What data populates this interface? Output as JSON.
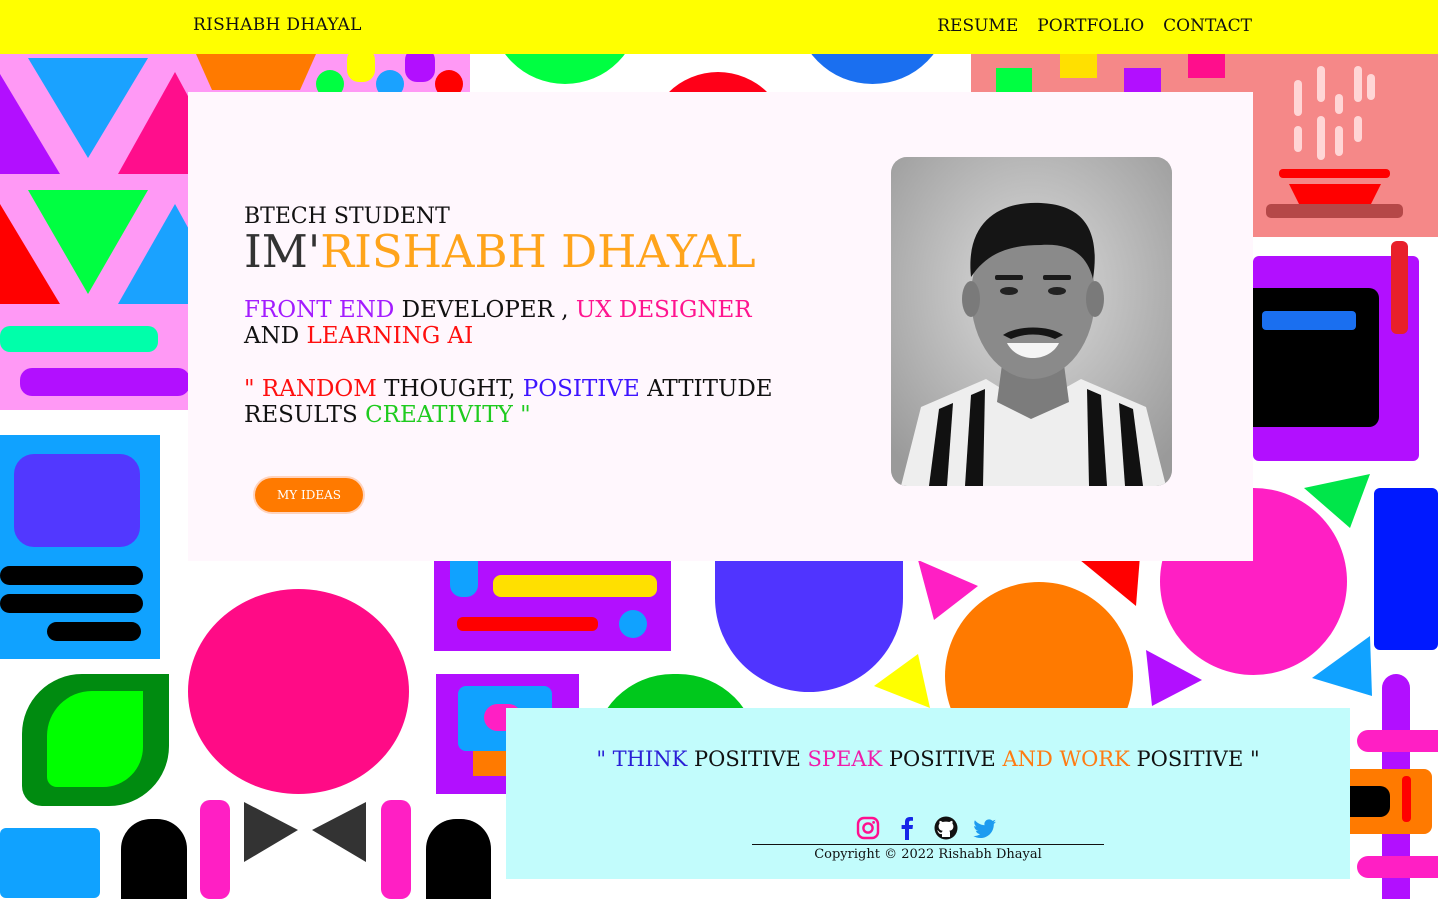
{
  "nav": {
    "brand": "RISHABH DHAYAL",
    "links": [
      "RESUME",
      "PORTFOLIO",
      "CONTACT"
    ]
  },
  "hero": {
    "subtitle": "BTECH STUDENT",
    "im_prefix": "IM'",
    "name": "RISHABH DHAYAL",
    "roles": {
      "front_end": "FRONT END",
      "developer": " DEVELOPER , ",
      "ux_designer": "UX DESIGNER",
      "and": "AND ",
      "learning_ai": "LEARNING AI"
    },
    "quote": {
      "open": "\" RANDOM",
      "thought": " THOUGHT, ",
      "positive": "POSITIVE",
      "attitude": " ATTITUDE",
      "results": "RESULTS ",
      "creativity": "CREATIVITY \""
    },
    "button_label": "MY IDEAS"
  },
  "footer": {
    "motto": {
      "open": "\" THINK",
      "pos1": " POSITIVE ",
      "speak": "SPEAK",
      "pos2": " POSITIVE ",
      "andwork": "AND WORK",
      "pos3": " POSITIVE \""
    },
    "socials": [
      "instagram-icon",
      "facebook-icon",
      "github-icon",
      "twitter-icon"
    ],
    "copyright": "Copyright © 2022 Rishabh Dhayal"
  },
  "colors": {
    "nav_bg": "#ffff00",
    "accent_name": "#ffa41b",
    "button": "#ff7a00",
    "footer_bg": "#c2fcfc",
    "hero_bg": "#fff7fd"
  }
}
